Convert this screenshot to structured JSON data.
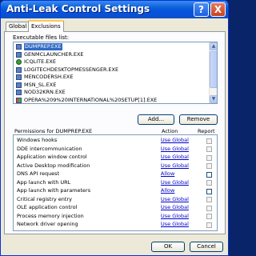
{
  "window": {
    "title": "Anti-Leak Control Settings"
  },
  "titlebar": {
    "help_glyph": "?",
    "close_glyph": "X"
  },
  "tabs": [
    {
      "label": "Global",
      "active": false
    },
    {
      "label": "Exclusions",
      "active": true
    }
  ],
  "files": {
    "label": "Executable files list:",
    "items": [
      {
        "name": "DUMPREP.EXE",
        "icon": "file-icon",
        "selected": true
      },
      {
        "name": "GENMCLAUNCHER.EXE",
        "icon": "file-icon",
        "selected": false
      },
      {
        "name": "ICQLITE.EXE",
        "icon": "gear-icon",
        "selected": false
      },
      {
        "name": "LOGITECHDESKTOPMESSENGER.EXE",
        "icon": "file-icon",
        "selected": false
      },
      {
        "name": "MENCODERSH.EXE",
        "icon": "file-icon",
        "selected": false
      },
      {
        "name": "MSN_SL.EXE",
        "icon": "file-icon",
        "selected": false
      },
      {
        "name": "NOD32KRN.EXE",
        "icon": "file-icon",
        "selected": false
      },
      {
        "name": "OPERA%209%20INTERNATIONAL%20SETUP[1].EXE",
        "icon": "windows-icon",
        "selected": false
      }
    ],
    "add_label": "Add...",
    "remove_label": "Remove"
  },
  "permissions": {
    "label": "Permissions for DUMPREP.EXE",
    "action_header": "Action",
    "report_header": "Report",
    "rows": [
      {
        "name": "Windows hooks",
        "action": "Use Global",
        "report_enabled": false
      },
      {
        "name": "DDE intercommunication",
        "action": "Use Global",
        "report_enabled": false
      },
      {
        "name": "Application window control",
        "action": "Use Global",
        "report_enabled": false
      },
      {
        "name": "Active Desktop modification",
        "action": "Use Global",
        "report_enabled": false
      },
      {
        "name": "DNS API request",
        "action": "Allow",
        "report_enabled": true
      },
      {
        "name": "App launch with URL",
        "action": "Use Global",
        "report_enabled": false
      },
      {
        "name": "App launch with parameters",
        "action": "Allow",
        "report_enabled": true
      },
      {
        "name": "Critical registry entry",
        "action": "Use Global",
        "report_enabled": false
      },
      {
        "name": "OLE application control",
        "action": "Use Global",
        "report_enabled": false
      },
      {
        "name": "Process memory injection",
        "action": "Use Global",
        "report_enabled": false
      },
      {
        "name": "Network driver opening",
        "action": "Use Global",
        "report_enabled": false
      }
    ]
  },
  "footer": {
    "ok_label": "OK",
    "cancel_label": "Cancel"
  }
}
